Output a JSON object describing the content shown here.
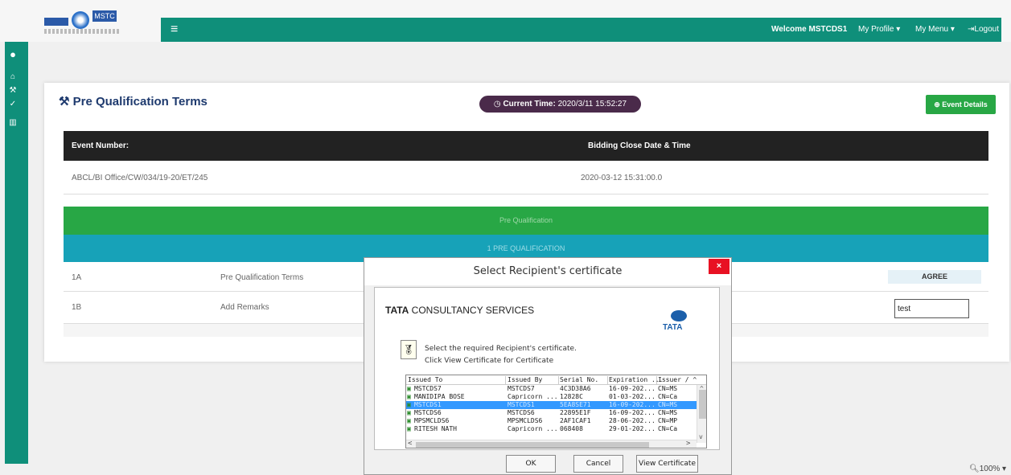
{
  "header": {
    "logo_text": "MSTC",
    "welcome": "Welcome MSTCDS1",
    "my_profile": "My Profile",
    "my_menu": "My Menu",
    "logout": "Logout"
  },
  "page": {
    "title": "Pre Qualification Terms",
    "current_time_label": "Current Time:",
    "current_time_value": "2020/3/11 15:52:27",
    "event_details_label": "Event Details",
    "table_head": {
      "event_number_label": "Event Number:",
      "bidding_close_label": "Bidding Close Date & Time"
    },
    "event_number": "ABCL/BI Office/CW/034/19-20/ET/245",
    "bidding_close": "2020-03-12 15:31:00.0",
    "section_pre": "Pre Qualification",
    "section_1": "1 PRE QUALIFICATION",
    "rows": [
      {
        "num": "1A",
        "label": "Pre Qualification Terms",
        "action": "AGREE"
      },
      {
        "num": "1B",
        "label": "Add Remarks",
        "input_value": "test"
      }
    ],
    "zoom": "100%"
  },
  "dialog": {
    "title": "Select Recipient's certificate",
    "close": "×",
    "company_bold": "TATA",
    "company_rest": "CONSULTANCY SERVICES",
    "logo_text": "TATA",
    "instruction_1": "Select the required Recipient's certificate.",
    "instruction_2": "Click View Certificate for Certificate",
    "columns": [
      "Issued To",
      "Issued By",
      "Serial No.",
      "Expiration ...",
      "Issuer / ^"
    ],
    "certs": [
      {
        "to": "MSTCDS7",
        "by": "MSTCDS7",
        "serial": "4C3D38A6",
        "exp": "16-09-202...",
        "issuer": "CN=MS"
      },
      {
        "to": "MANIDIPA BOSE",
        "by": "Capricorn ...",
        "serial": "12828C",
        "exp": "01-03-202...",
        "issuer": "CN=Ca"
      },
      {
        "to": "MSTCDS1",
        "by": "MSTCDS1",
        "serial": "5EA8SE71",
        "exp": "16-09-202...",
        "issuer": "CN=MS"
      },
      {
        "to": "MSTCDS6",
        "by": "MSTCDS6",
        "serial": "22895E1F",
        "exp": "16-09-202...",
        "issuer": "CN=MS"
      },
      {
        "to": "MPSMCLDS6",
        "by": "MPSMCLDS6",
        "serial": "2AF1CAF1",
        "exp": "28-06-202...",
        "issuer": "CN=MP"
      },
      {
        "to": "RITESH NATH",
        "by": "Capricorn ...",
        "serial": "068408",
        "exp": "29-01-202...",
        "issuer": "CN=Ca"
      }
    ],
    "selected_index": 2,
    "ok_label": "OK",
    "cancel_label": "Cancel",
    "view_label": "View Certificate"
  },
  "icons": {
    "menu": "hamburger-icon",
    "clock": "clock-icon",
    "gavel": "gavel-icon",
    "plus": "plus-circle-icon",
    "logout": "logout-icon"
  },
  "colors": {
    "nav_teal": "#0f8f7a",
    "header_dark": "#222222",
    "section_green": "#28a745",
    "section_teal": "#17a2b8",
    "time_pill": "#4a2a4a",
    "selection_blue": "#3399ff",
    "close_red": "#e81123"
  }
}
